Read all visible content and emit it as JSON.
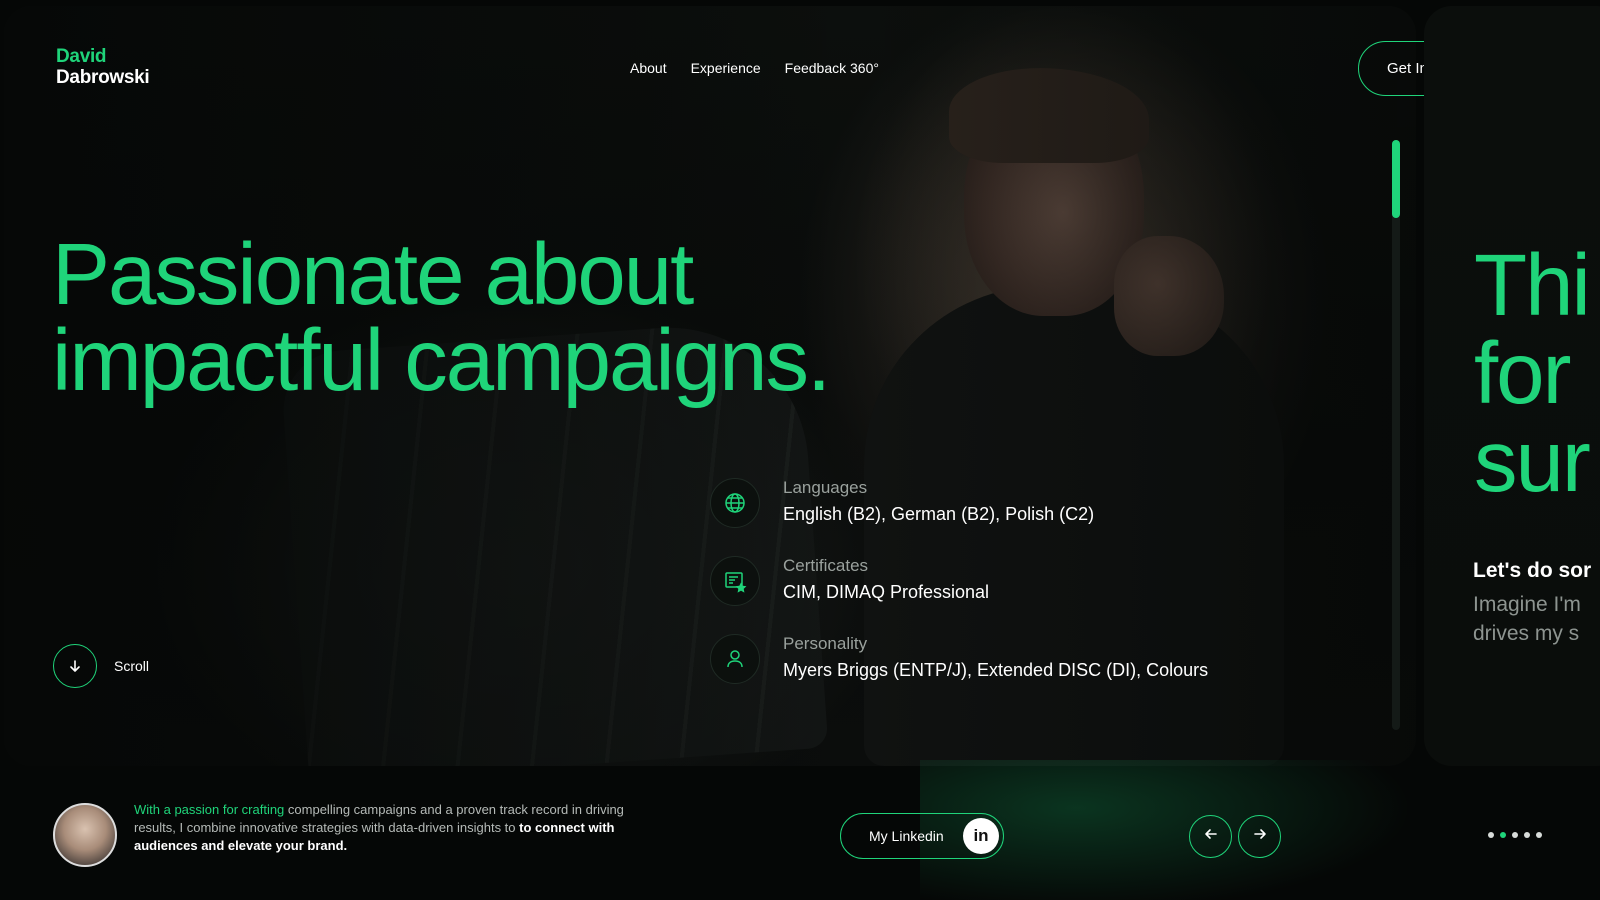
{
  "brand": {
    "first_name": "David",
    "last_name": "Dabrowski"
  },
  "nav": {
    "items": [
      "About",
      "Experience",
      "Feedback 360°"
    ]
  },
  "cta": {
    "label": "Get In Touch",
    "icon": "arrow-up-right-icon"
  },
  "hero": {
    "headline_line1": "Passionate about",
    "headline_line2": "impactful campaigns.",
    "info": [
      {
        "label": "Languages",
        "value": "English (B2), German (B2), Polish (C2)",
        "icon": "globe-icon"
      },
      {
        "label": "Certificates",
        "value": "CIM, DIMAQ Professional",
        "icon": "certificate-icon"
      },
      {
        "label": "Personality",
        "value": "Myers Briggs (ENTP/J), Extended DISC (DI), Colours",
        "icon": "user-icon"
      }
    ],
    "scroll_label": "Scroll"
  },
  "next_card": {
    "big_line1": "Thi",
    "big_line2": "for",
    "big_line3": "sur",
    "sub1": "Let's do sor",
    "sub2_line1": "Imagine I'm",
    "sub2_line2": "drives my s"
  },
  "bio": {
    "highlight": "With a passion for crafting",
    "text": " compelling campaigns and a proven track record in driving results, I combine innovative strategies with data-driven insights to ",
    "strong": "to connect with audiences and elevate your brand."
  },
  "linkedin": {
    "label": "My Linkedin",
    "icon_text": "in"
  },
  "pager": {
    "prev_icon": "arrow-left-icon",
    "next_icon": "arrow-right-icon",
    "active_index": 1,
    "count": 5
  },
  "colors": {
    "accent": "#1fd47a",
    "background": "#050706"
  }
}
